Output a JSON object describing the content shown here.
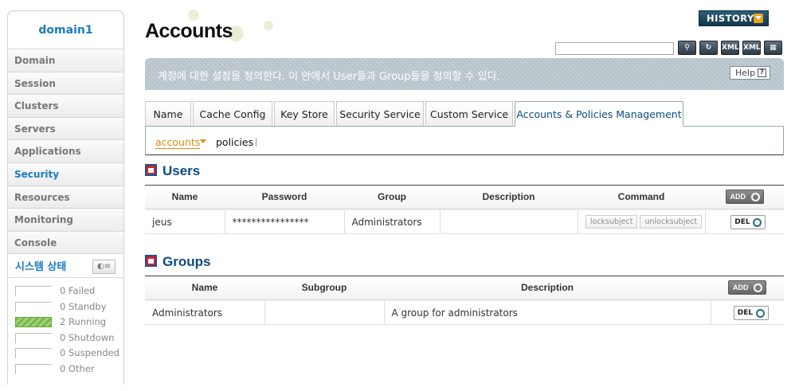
{
  "sidebar": {
    "title": "domain1",
    "items": [
      {
        "label": "Domain"
      },
      {
        "label": "Session"
      },
      {
        "label": "Clusters"
      },
      {
        "label": "Servers"
      },
      {
        "label": "Applications"
      },
      {
        "label": "Security"
      },
      {
        "label": "Resources"
      },
      {
        "label": "Monitoring"
      },
      {
        "label": "Console"
      }
    ],
    "active_item": "Security",
    "status_title": "시스템 상태",
    "status": [
      {
        "count": "0",
        "label": "Failed"
      },
      {
        "count": "0",
        "label": "Standby"
      },
      {
        "count": "2",
        "label": "Running"
      },
      {
        "count": "0",
        "label": "Shutdown"
      },
      {
        "count": "0",
        "label": "Suspended"
      },
      {
        "count": "0",
        "label": "Other"
      }
    ]
  },
  "header": {
    "title": "Accounts",
    "history_label": "HISTORY",
    "search_value": "",
    "tools": [
      "search-icon",
      "refresh-icon",
      "xml-export-icon",
      "xml-import-icon",
      "save-icon"
    ],
    "tool_labels": {
      "xml1": "XML",
      "xml2": "XML"
    }
  },
  "info": {
    "text": "계정에 대한 설정을 정의한다. 이 안에서 User들과 Group들을 정의할 수 있다.",
    "help_label": "Help",
    "help_q": "?"
  },
  "tabs": [
    {
      "label": "Name"
    },
    {
      "label": "Cache Config"
    },
    {
      "label": "Key Store"
    },
    {
      "label": "Security Service"
    },
    {
      "label": "Custom Service"
    },
    {
      "label": "Accounts & Policies Management"
    }
  ],
  "subtabs": {
    "accounts": "accounts",
    "policies": "policies"
  },
  "users": {
    "title": "Users",
    "columns": {
      "name": "Name",
      "password": "Password",
      "group": "Group",
      "description": "Description",
      "command": "Command"
    },
    "add_label": "ADD",
    "rows": [
      {
        "name": "jeus",
        "password": "****************",
        "group": "Administrators",
        "description": "",
        "lock_label": "locksubject",
        "unlock_label": "unlocksubject",
        "del_label": "DEL"
      }
    ]
  },
  "groups": {
    "title": "Groups",
    "columns": {
      "name": "Name",
      "subgroup": "Subgroup",
      "description": "Description"
    },
    "add_label": "ADD",
    "rows": [
      {
        "name": "Administrators",
        "subgroup": "",
        "description": "A group for administrators",
        "del_label": "DEL"
      }
    ]
  },
  "colors": {
    "accent_blue": "#1a7bbf",
    "title_blue": "#0b4b80",
    "subtab_orange": "#e08b0f",
    "running_green": "#7ab94e"
  }
}
